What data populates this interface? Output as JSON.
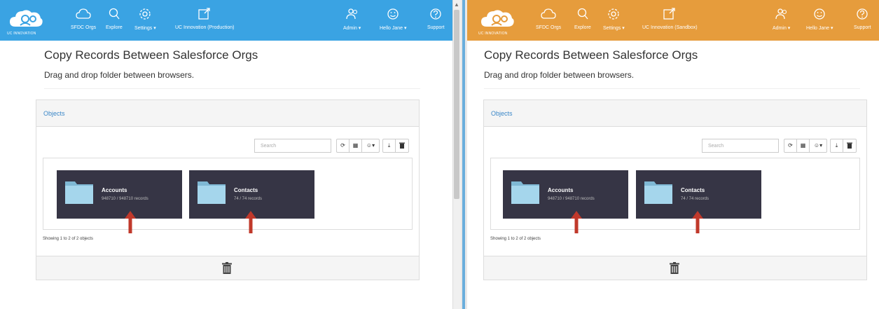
{
  "left": {
    "logo_tag": "UC INNOVATION",
    "nav": {
      "sfdc_orgs": "SFDC Orgs",
      "explore": "Explore",
      "settings": "Settings",
      "org": "UC Innovation (Production)",
      "admin": "Admin",
      "hello": "Hello Jane",
      "support": "Support"
    },
    "page_title": "Copy Records Between Salesforce Orgs",
    "page_subtitle": "Drag and drop folder between browsers.",
    "panel_heading": "Objects",
    "search_placeholder": "Search",
    "folders": [
      {
        "name": "Accounts",
        "count": "948710 / 948710 records"
      },
      {
        "name": "Contacts",
        "count": "74 / 74 records"
      }
    ],
    "showing": "Showing 1 to 2 of 2 objects"
  },
  "right": {
    "logo_tag": "UC INNOVATION",
    "nav": {
      "sfdc_orgs": "SFDC Orgs",
      "explore": "Explore",
      "settings": "Settings",
      "org": "UC Innovation (Sandbox)",
      "admin": "Admin",
      "hello": "Hello Jane",
      "support": "Support"
    },
    "page_title": "Copy Records Between Salesforce Orgs",
    "page_subtitle": "Drag and drop folder between browsers.",
    "panel_heading": "Objects",
    "search_placeholder": "Search",
    "folders": [
      {
        "name": "Accounts",
        "count": "948710 / 948710 records"
      },
      {
        "name": "Contacts",
        "count": "74 / 74 records"
      }
    ],
    "showing": "Showing 1 to 2 of 2 objects"
  },
  "icons": {
    "caret": "▾",
    "refresh": "⟳",
    "calendar": "▦",
    "user": "☺",
    "download": "⤓",
    "trash": "trash-icon"
  },
  "colors": {
    "production_bar": "#3aa3e3",
    "sandbox_bar": "#e69c3c",
    "folder_tile": "#363545",
    "folder_icon": "#8ecbe6",
    "arrow": "#c0392b",
    "link": "#3a87c8"
  }
}
